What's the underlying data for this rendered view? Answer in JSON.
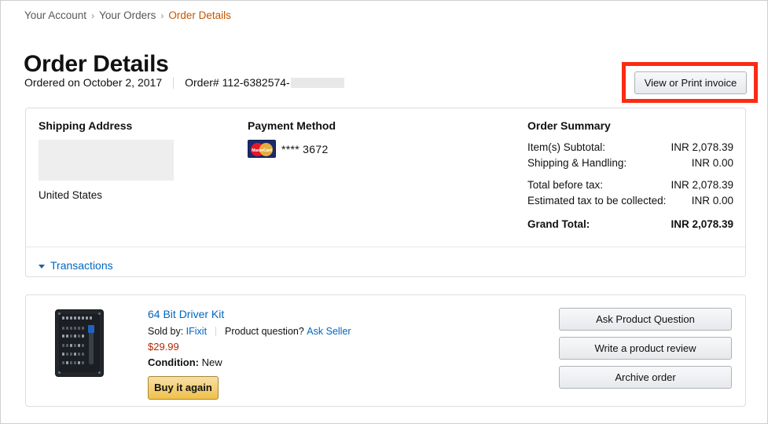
{
  "breadcrumb": {
    "items": [
      {
        "label": "Your Account",
        "current": false
      },
      {
        "label": "Your Orders",
        "current": false
      },
      {
        "label": "Order Details",
        "current": true
      }
    ],
    "separator": "›"
  },
  "page": {
    "title": "Order Details"
  },
  "order_meta": {
    "ordered_on": "Ordered on October 2, 2017",
    "order_number": "Order# 112-6382574-"
  },
  "invoice": {
    "button_label": "View or Print invoice",
    "highlight_color": "#fc2b12"
  },
  "shipping": {
    "heading": "Shipping Address",
    "country": "United States"
  },
  "payment": {
    "heading": "Payment Method",
    "card_brand": "MasterCard",
    "card_digits": "**** 3672"
  },
  "order_summary": {
    "heading": "Order Summary",
    "rows": [
      {
        "label": "Item(s) Subtotal:",
        "value": "INR 2,078.39",
        "spaced": false,
        "bold": false
      },
      {
        "label": "Shipping & Handling:",
        "value": "INR 0.00",
        "spaced": false,
        "bold": false
      },
      {
        "label": "Total before tax:",
        "value": "INR 2,078.39",
        "spaced": true,
        "bold": false
      },
      {
        "label": "Estimated tax to be collected:",
        "value": "INR 0.00",
        "spaced": false,
        "bold": false
      },
      {
        "label": "Grand Total:",
        "value": "INR 2,078.39",
        "spaced": true,
        "bold": true
      }
    ]
  },
  "transactions": {
    "label": "Transactions"
  },
  "item": {
    "title": "64 Bit Driver Kit",
    "sold_by_label": "Sold by:",
    "seller": "IFixit",
    "question_label": "Product question?",
    "ask_seller": "Ask Seller",
    "price": "$29.99",
    "condition_label": "Condition:",
    "condition_value": "New",
    "buy_again_label": "Buy it again"
  },
  "item_actions": [
    {
      "label": "Ask Product Question"
    },
    {
      "label": "Write a product review"
    },
    {
      "label": "Archive order"
    }
  ]
}
